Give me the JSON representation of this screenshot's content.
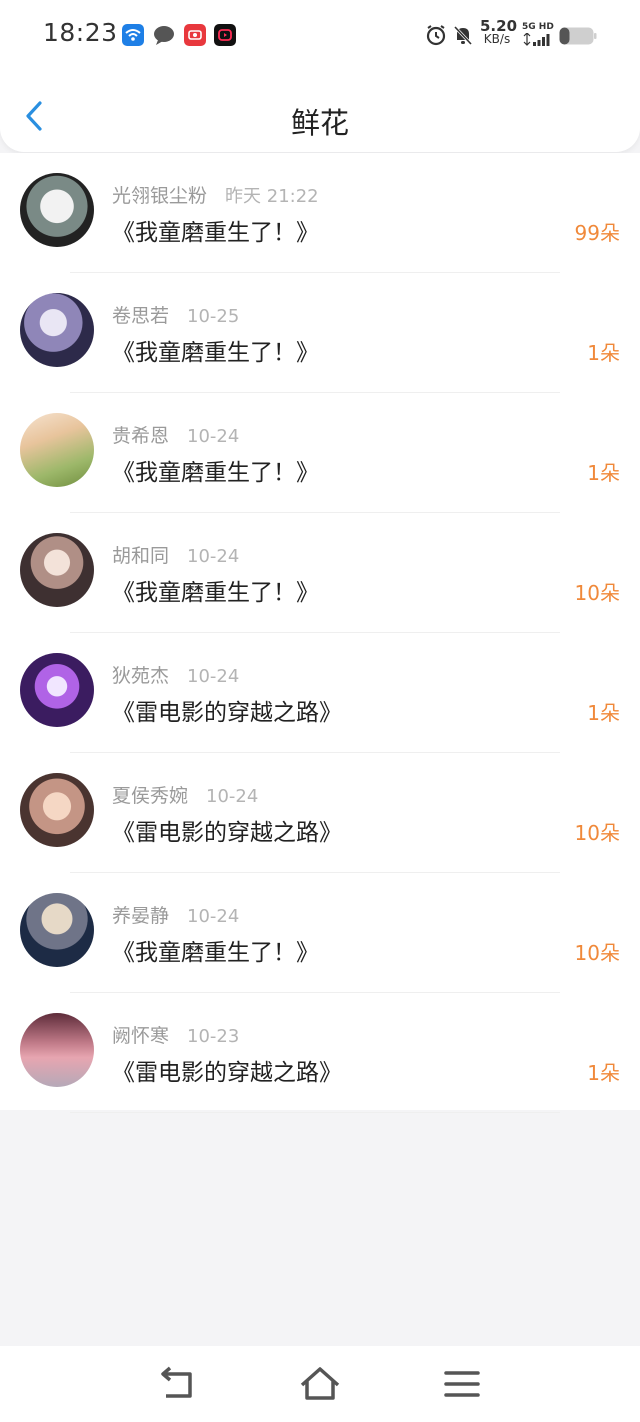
{
  "status_bar": {
    "time": "18:23",
    "net_speed_value": "5.20",
    "net_speed_unit": "KB/s",
    "network_label": "5G HD",
    "icons": [
      "wifi-app-icon",
      "chat-bubble-icon",
      "red-app-icon",
      "video-app-icon",
      "alarm-icon",
      "mute-bell-icon",
      "signal-icon",
      "battery-icon"
    ]
  },
  "header": {
    "title": "鲜花",
    "back_icon": "chevron-left-icon",
    "accent_color": "#2a8fe0"
  },
  "colors": {
    "count_color": "#f0893a",
    "name_color": "#9a9a9a",
    "date_color": "#b4b4b4"
  },
  "records": [
    {
      "name": "光翎银尘粉",
      "date": "昨天 21:22",
      "book": "《我童磨重生了！》",
      "count": "99朵"
    },
    {
      "name": "卷思若",
      "date": "10-25",
      "book": "《我童磨重生了！》",
      "count": "1朵"
    },
    {
      "name": "贵希恩",
      "date": "10-24",
      "book": "《我童磨重生了！》",
      "count": "1朵"
    },
    {
      "name": "胡和同",
      "date": "10-24",
      "book": "《我童磨重生了！》",
      "count": "10朵"
    },
    {
      "name": "狄苑杰",
      "date": "10-24",
      "book": "《雷电影的穿越之路》",
      "count": "1朵"
    },
    {
      "name": "夏侯秀婉",
      "date": "10-24",
      "book": "《雷电影的穿越之路》",
      "count": "10朵"
    },
    {
      "name": "养晏静",
      "date": "10-24",
      "book": "《我童磨重生了！》",
      "count": "10朵"
    },
    {
      "name": "阙怀寒",
      "date": "10-23",
      "book": "《雷电影的穿越之路》",
      "count": "1朵"
    }
  ],
  "nav_bar": {
    "icons": [
      "back-nav-icon",
      "home-icon",
      "menu-icon"
    ]
  }
}
